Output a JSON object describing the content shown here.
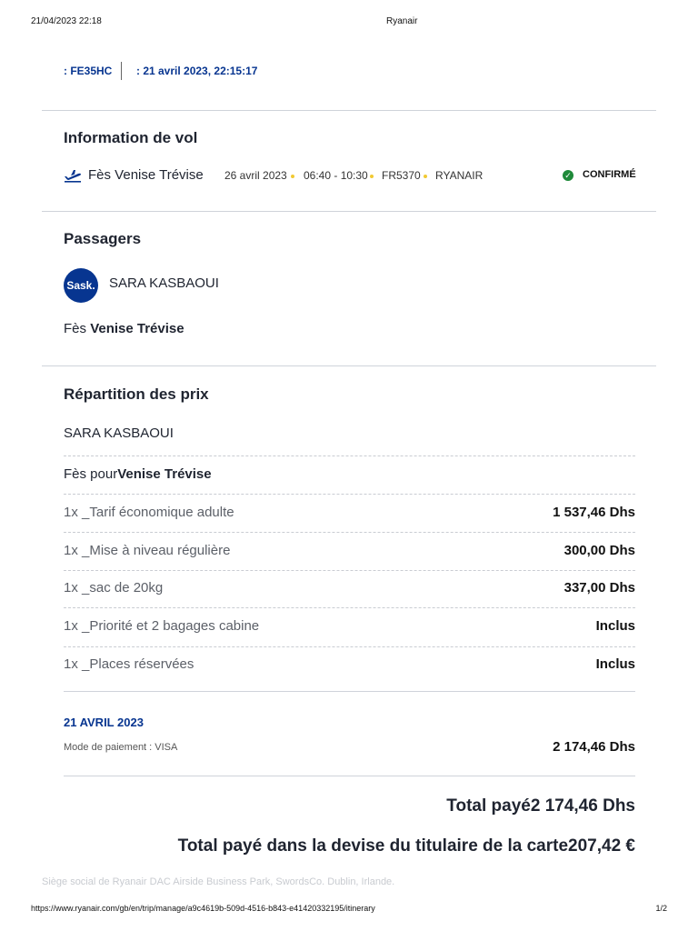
{
  "print_header": {
    "datetime": "21/04/2023 22:18",
    "title": "Ryanair"
  },
  "booking": {
    "reference": ": FE35HC",
    "date": ": 21 avril 2023, 22:15:17"
  },
  "flight_info": {
    "heading": "Information de vol",
    "icon": "plane-takeoff-icon",
    "route": "Fès Venise Trévise",
    "date": "26 avril 2023",
    "times": "06:40 - 10:30",
    "flight_number": "FR5370",
    "carrier": "RYANAIR",
    "status": "CONFIRMÉ",
    "status_color": "#1f8a3a"
  },
  "passengers": {
    "heading": "Passagers",
    "avatar_initials": "Sask.",
    "name": "SARA KASBAOUI",
    "route_from": "Fès ",
    "route_to": "Venise Trévise"
  },
  "pricing": {
    "heading": "Répartition des prix",
    "passenger": "SARA KASBAOUI",
    "journey_from": "Fès pour",
    "journey_to": "Venise Trévise",
    "items": [
      {
        "label": "1x _Tarif économique adulte",
        "value": "1 537,46 Dhs"
      },
      {
        "label": "1x _Mise à niveau régulière",
        "value": "300,00 Dhs"
      },
      {
        "label": "1x _sac de 20kg",
        "value": "337,00 Dhs"
      },
      {
        "label": "1x _Priorité et 2 bagages cabine",
        "value": "Inclus"
      },
      {
        "label": "1x _Places réservées",
        "value": "Inclus"
      }
    ]
  },
  "payment": {
    "date": "21 AVRIL 2023",
    "method": "Mode de paiement : VISA",
    "amount": "2 174,46 Dhs",
    "total_paid": "Total payé2 174,46 Dhs",
    "total_card_currency": "Total payé dans la devise du titulaire de la carte207,42 €"
  },
  "footer": {
    "registered_office": "Siège social de Ryanair DAC Airside Business Park, SwordsCo. Dublin, Irlande.",
    "url": "https://www.ryanair.com/gb/en/trip/manage/a9c4619b-509d-4516-b843-e41420332195/itinerary",
    "page": "1/2"
  },
  "colors": {
    "brand_blue": "#073590",
    "dot_yellow": "#f1c933",
    "divider": "#cfd3da"
  }
}
